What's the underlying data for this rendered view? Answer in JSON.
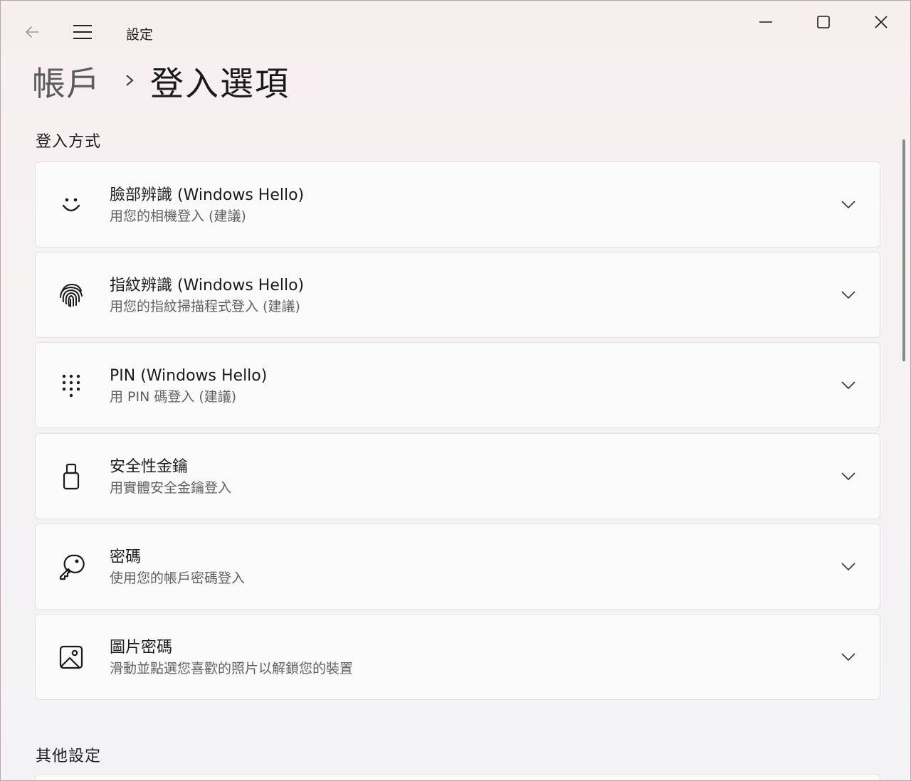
{
  "window": {
    "app_title": "設定",
    "back_icon": "back-arrow-icon",
    "menu_icon": "hamburger-menu-icon",
    "controls": {
      "minimize_icon": "minimize-icon",
      "maximize_icon": "maximize-icon",
      "close_icon": "close-icon"
    }
  },
  "breadcrumb": {
    "parent": "帳戶",
    "separator_icon": "chevron-right-icon",
    "current": "登入選項"
  },
  "sections": {
    "sign_in_methods": {
      "title": "登入方式",
      "items": [
        {
          "icon": "face-icon",
          "title": "臉部辨識 (Windows Hello)",
          "subtitle": "用您的相機登入 (建議)"
        },
        {
          "icon": "fingerprint-icon",
          "title": "指紋辨識 (Windows Hello)",
          "subtitle": "用您的指紋掃描程式登入 (建議)"
        },
        {
          "icon": "pin-keypad-icon",
          "title": "PIN (Windows Hello)",
          "subtitle": "用 PIN 碼登入 (建議)"
        },
        {
          "icon": "usb-key-icon",
          "title": "安全性金鑰",
          "subtitle": "用實體安全金鑰登入"
        },
        {
          "icon": "key-icon",
          "title": "密碼",
          "subtitle": "使用您的帳戶密碼登入"
        },
        {
          "icon": "picture-icon",
          "title": "圖片密碼",
          "subtitle": "滑動並點選您喜歡的照片以解鎖您的裝置"
        }
      ]
    },
    "other_settings": {
      "title": "其他設定"
    }
  },
  "colors": {
    "background": "#f6f2f3",
    "card": "#fbfbfc",
    "text_primary": "#1b1b1b",
    "text_secondary": "#616161"
  }
}
